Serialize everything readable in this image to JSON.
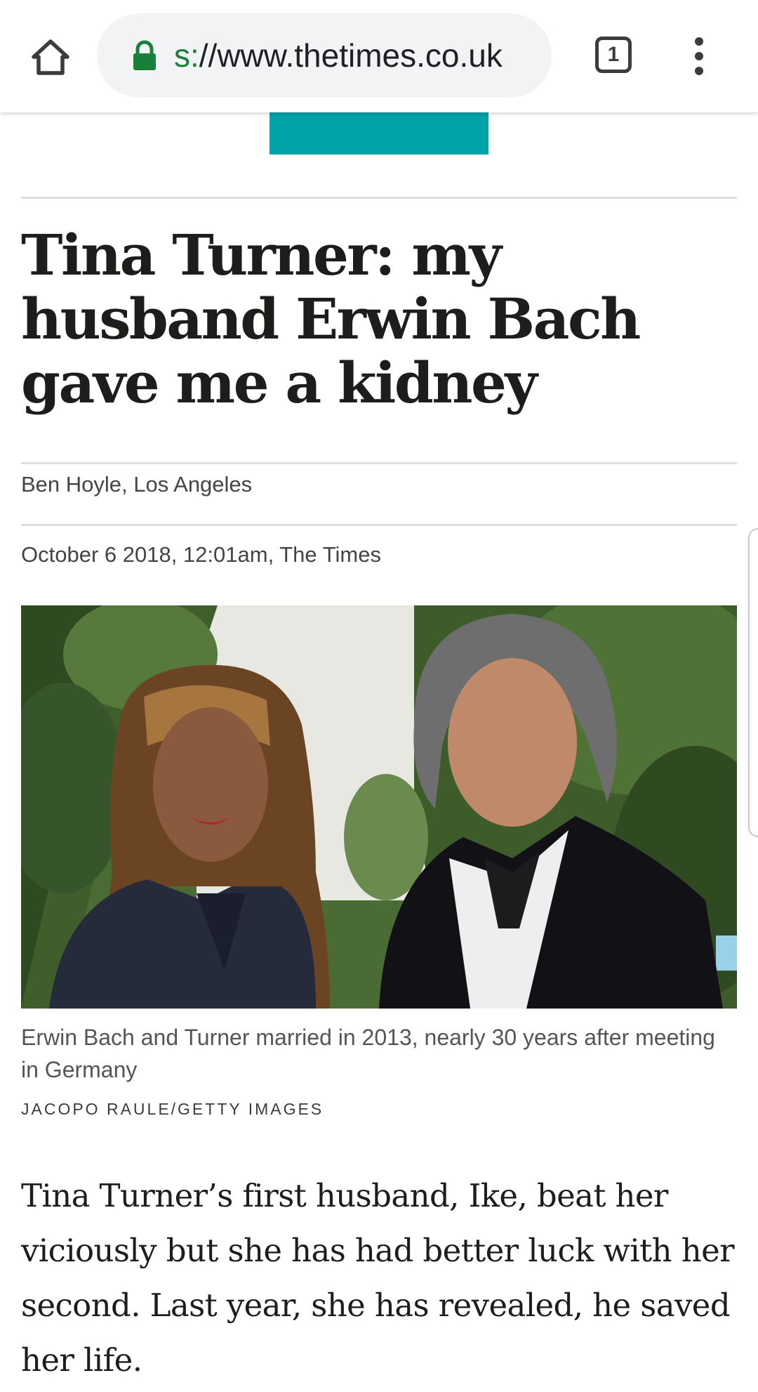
{
  "browser": {
    "url_scheme": "s:",
    "url_rest": "//www.thetimes.co.uk",
    "tab_count": "1",
    "icons": {
      "home": "home-icon",
      "lock": "lock-icon",
      "tabs": "tab-switcher-icon",
      "menu": "overflow-menu-icon"
    },
    "lock_color": "#188038"
  },
  "article": {
    "accent_color": "#00a3a8",
    "headline": "Tina Turner: my husband Erwin Bach gave me a kidney",
    "byline": "Ben Hoyle, Los Angeles",
    "dateline": "October 6 2018, 12:01am, The Times",
    "image": {
      "caption": "Erwin Bach and Turner married in 2013, nearly 30 years after meeting in Germany",
      "credit": "JACOPO RAULE/GETTY IMAGES"
    },
    "body": "Tina Turner’s first husband, Ike, beat her viciously but she has had better luck with her second. Last year, she has revealed, he saved her life."
  }
}
